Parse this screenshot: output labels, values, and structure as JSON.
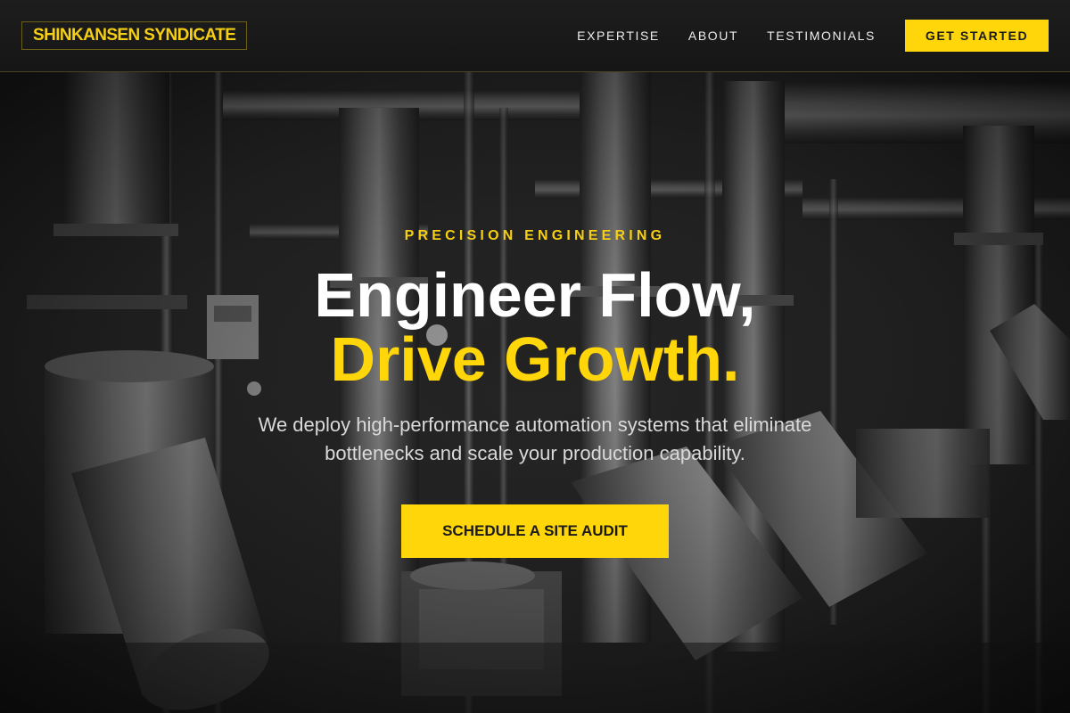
{
  "brand": {
    "logo_text": "SHINKANSEN SYNDICATE",
    "accent": "#FFD60A"
  },
  "nav": {
    "links": [
      "EXPERTISE",
      "ABOUT",
      "TESTIMONIALS"
    ],
    "cta_label": "GET STARTED"
  },
  "hero": {
    "eyebrow": "PRECISION ENGINEERING",
    "headline_line1": "Engineer Flow,",
    "headline_line2": "Drive Growth.",
    "subtext": "We deploy high-performance automation systems that eliminate bottlenecks and scale your production capability.",
    "cta_label": "SCHEDULE A SITE AUDIT",
    "background_image": "industrial-pipes-photo"
  }
}
